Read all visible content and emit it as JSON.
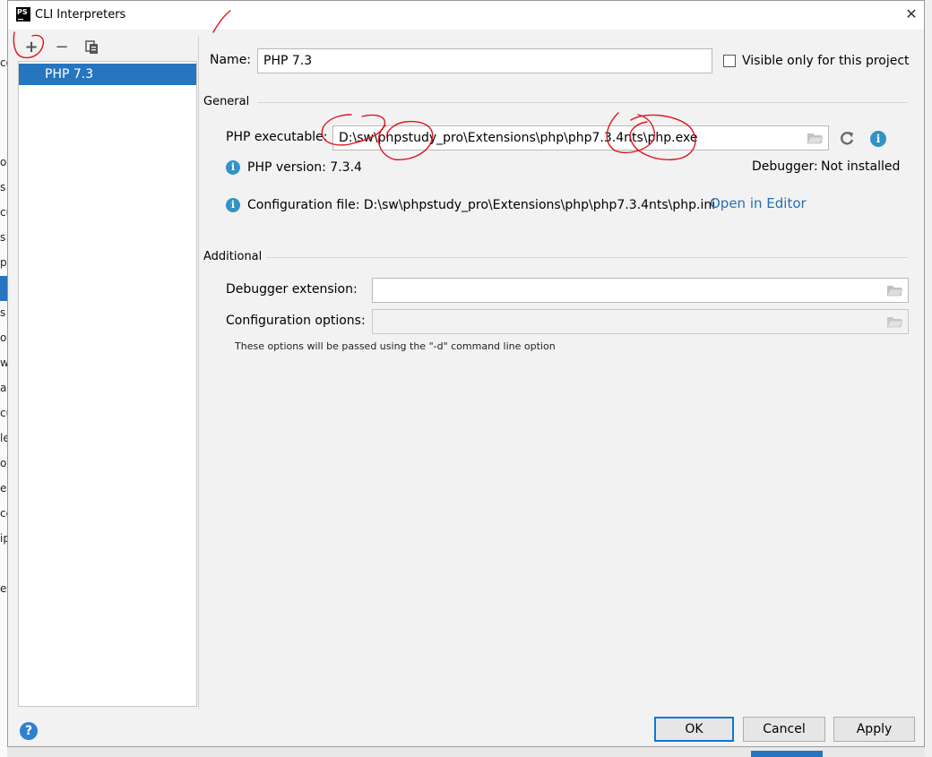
{
  "window": {
    "title": "CLI Interpreters",
    "app_icon_text": "PS",
    "close_glyph": "✕"
  },
  "left_panel": {
    "toolbar": {
      "add_glyph": "+",
      "remove_glyph": "−"
    },
    "items": [
      {
        "label": "PHP 7.3"
      }
    ]
  },
  "name_row": {
    "label": "Name:",
    "value": "PHP 7.3",
    "checkbox_label": "Visible only for this project",
    "checkbox_checked": false
  },
  "general": {
    "section_label": "General",
    "php_executable_label": "PHP executable:",
    "php_executable_value": "D:\\sw\\phpstudy_pro\\Extensions\\php\\php7.3.4nts\\php.exe",
    "php_version_text": "PHP version: 7.3.4",
    "debugger_label": "Debugger:",
    "debugger_value": "Not installed",
    "config_file_text": "Configuration file: D:\\sw\\phpstudy_pro\\Extensions\\php\\php7.3.4nts\\php.ini",
    "open_in_editor_link": "Open in Editor"
  },
  "additional": {
    "section_label": "Additional",
    "debugger_extension_label": "Debugger extension:",
    "debugger_extension_value": "",
    "configuration_options_label": "Configuration options:",
    "configuration_options_value": "",
    "hint": "These options will be passed using the \"-d\" command line option"
  },
  "footer": {
    "help_glyph": "?",
    "ok_label": "OK",
    "cancel_label": "Cancel",
    "apply_label": "Apply"
  },
  "background_window": {
    "fragments": [
      "co",
      "or",
      "s",
      "cu",
      "s",
      "p",
      "s",
      "op",
      "w",
      "a",
      "cu",
      "le",
      "o",
      "e",
      "ce",
      "ip",
      "e"
    ]
  },
  "colors": {
    "selection": "#2675bf",
    "link": "#2470b3",
    "info_icon": "#3592c4",
    "ok_border": "#0b78d7",
    "annotation": "#e0141e"
  }
}
